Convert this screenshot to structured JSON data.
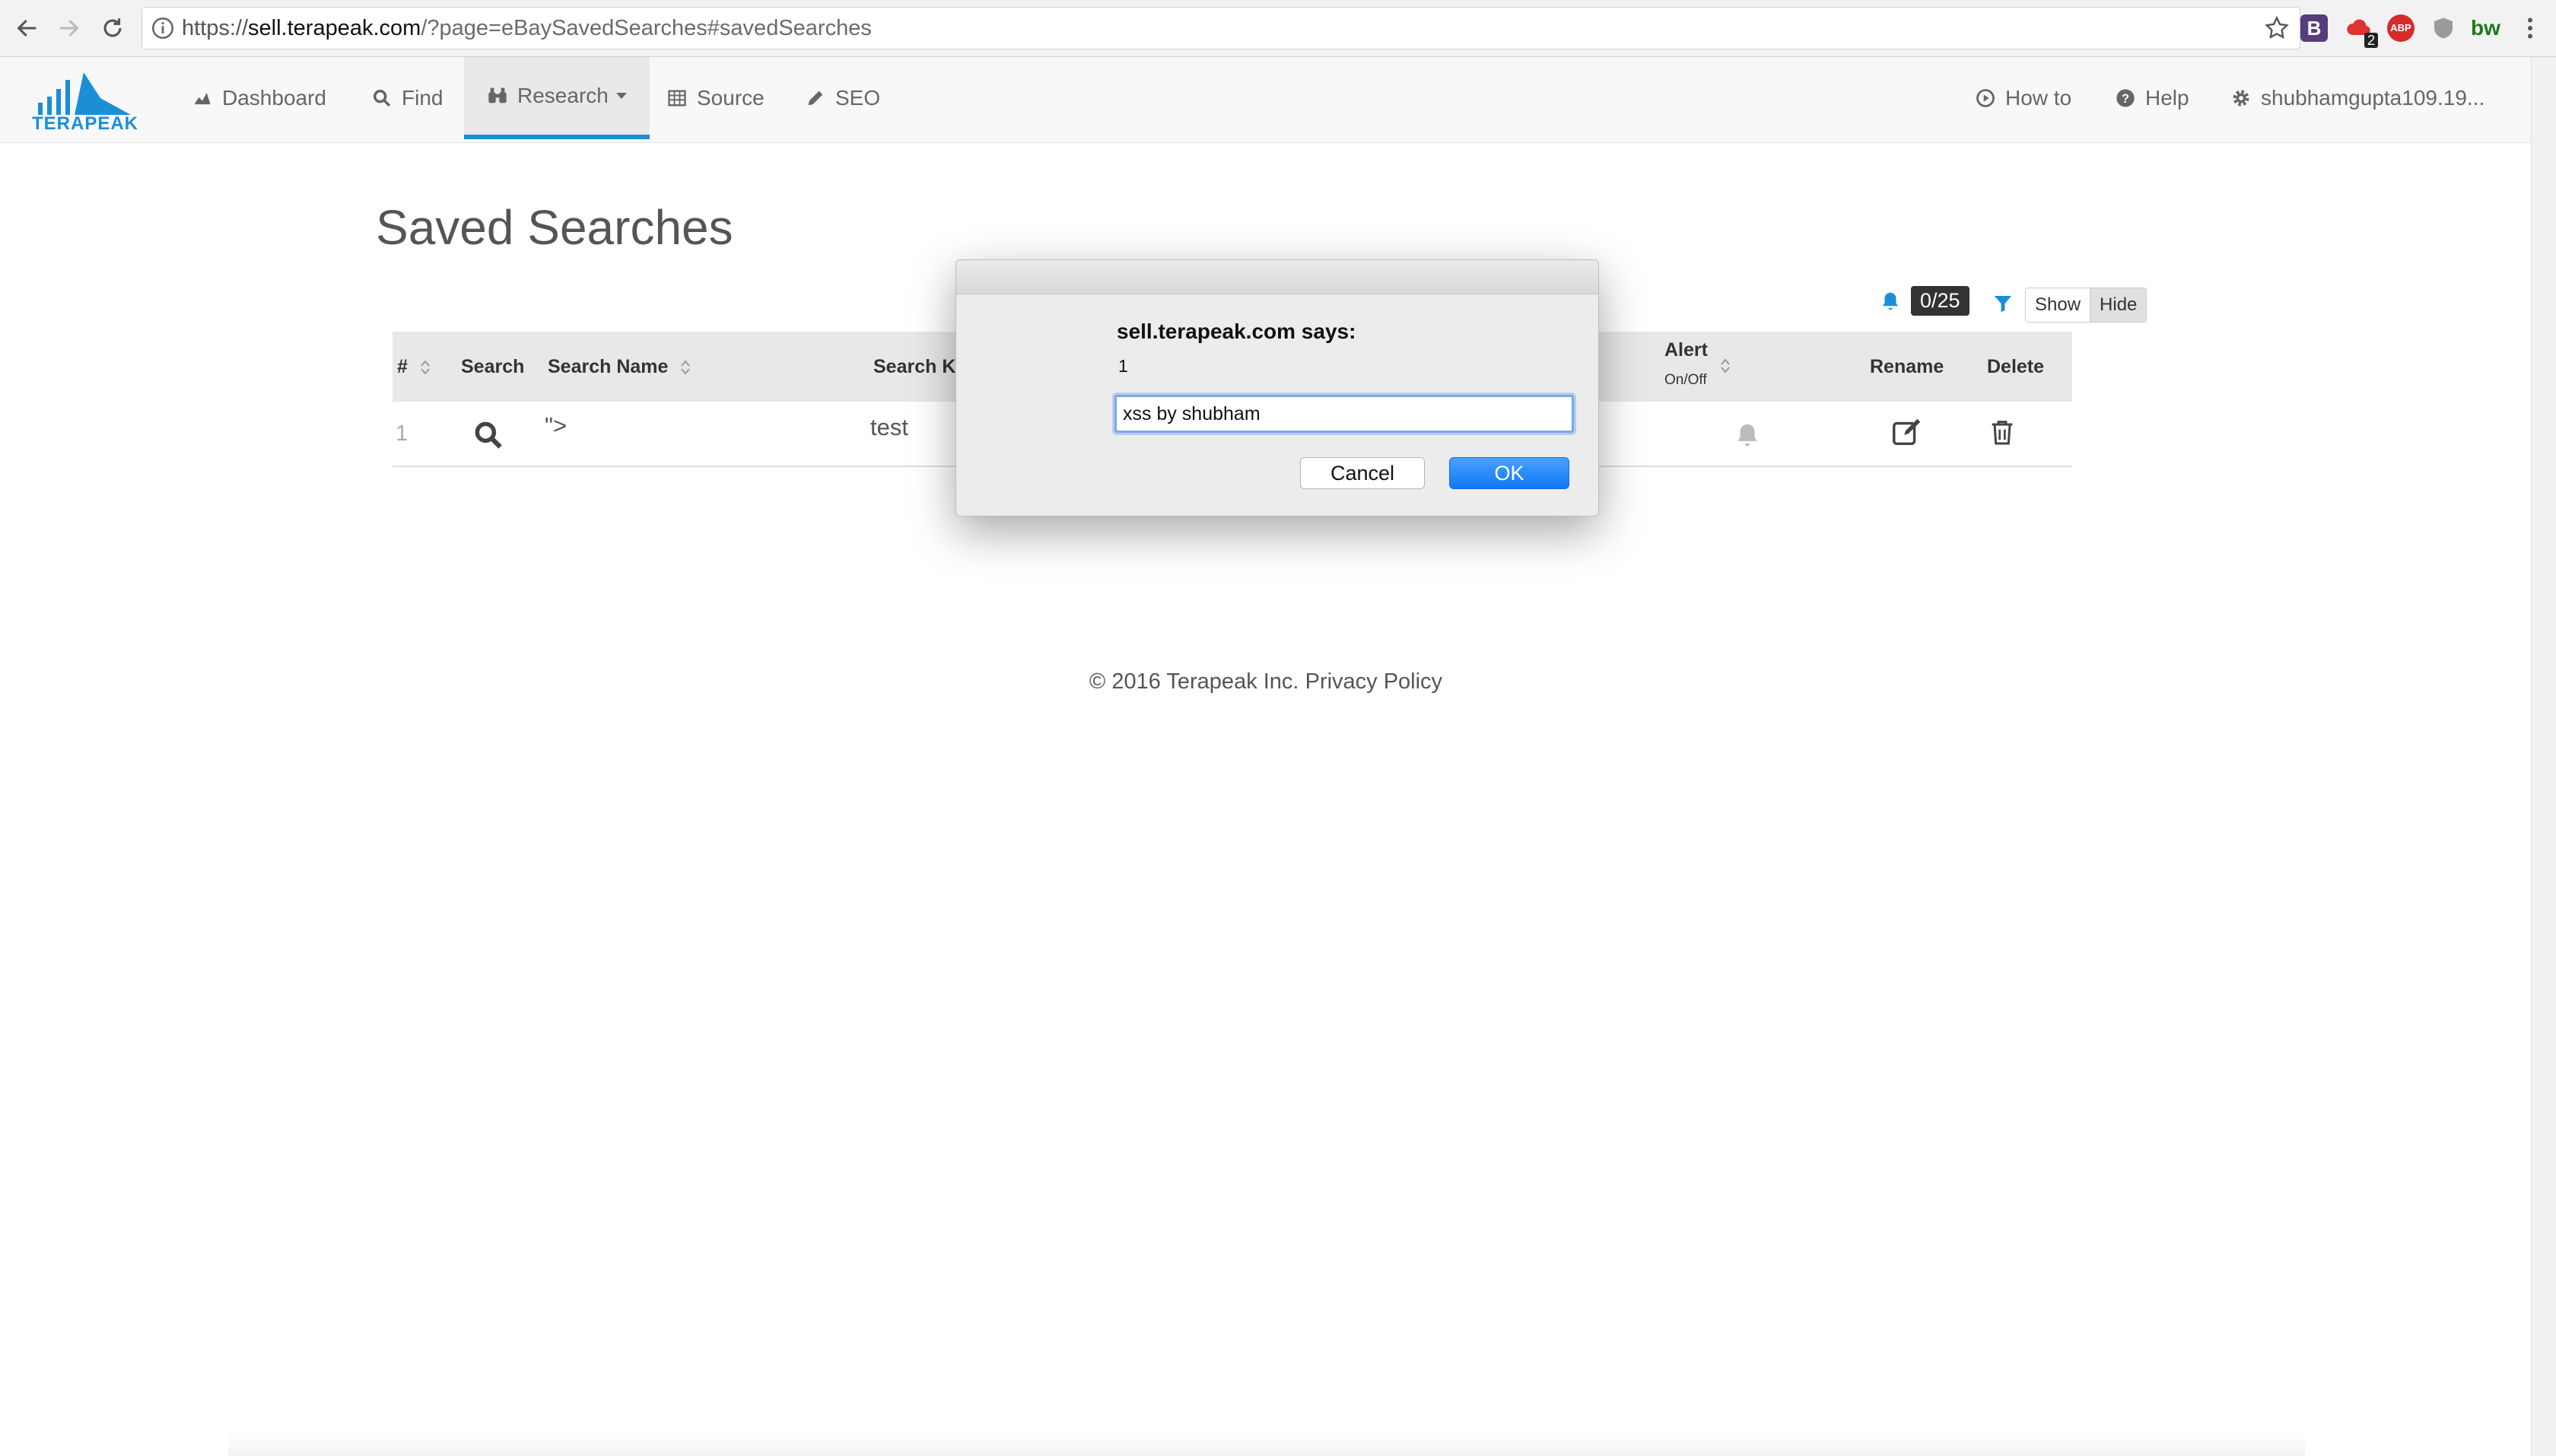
{
  "browser": {
    "url_scheme": "https://",
    "url_host": "sell.terapeak.com",
    "url_rest": "/?page=eBaySavedSearches#savedSearches",
    "extensions": [
      {
        "name": "bootstrap-extension",
        "label": "B"
      },
      {
        "name": "lastpass-extension",
        "badge": "2"
      },
      {
        "name": "adblock-extension",
        "label": "ABP"
      },
      {
        "name": "shield-extension"
      },
      {
        "name": "builtwith-extension",
        "label": "bw"
      }
    ]
  },
  "header": {
    "logo_text": "TERAPEAK",
    "nav": {
      "dashboard": "Dashboard",
      "find": "Find",
      "research": "Research",
      "source": "Source",
      "seo": "SEO",
      "howto": "How to",
      "help": "Help",
      "user": "shubhamgupta109.19..."
    }
  },
  "page": {
    "title": "Saved Searches",
    "alert_count": "0/25",
    "toggle": {
      "show": "Show",
      "hide": "Hide"
    },
    "table": {
      "headers": {
        "num": "#",
        "search": "Search",
        "search_name": "Search Name",
        "search_keyword": "Search Ke",
        "alert": "Alert",
        "alert_sub": "On/Off",
        "rename": "Rename",
        "delete": "Delete"
      },
      "rows": [
        {
          "num": "1",
          "name": "\">",
          "keyword": "test"
        }
      ]
    },
    "footer": {
      "copyright": "© 2016 Terapeak Inc.",
      "privacy": "Privacy Policy"
    }
  },
  "dialog": {
    "title": "sell.terapeak.com says:",
    "message": "1",
    "input_value": "xss by shubham",
    "cancel": "Cancel",
    "ok": "OK"
  },
  "colors": {
    "accent": "#1a8fd6",
    "ok_button": "#1177f5"
  }
}
